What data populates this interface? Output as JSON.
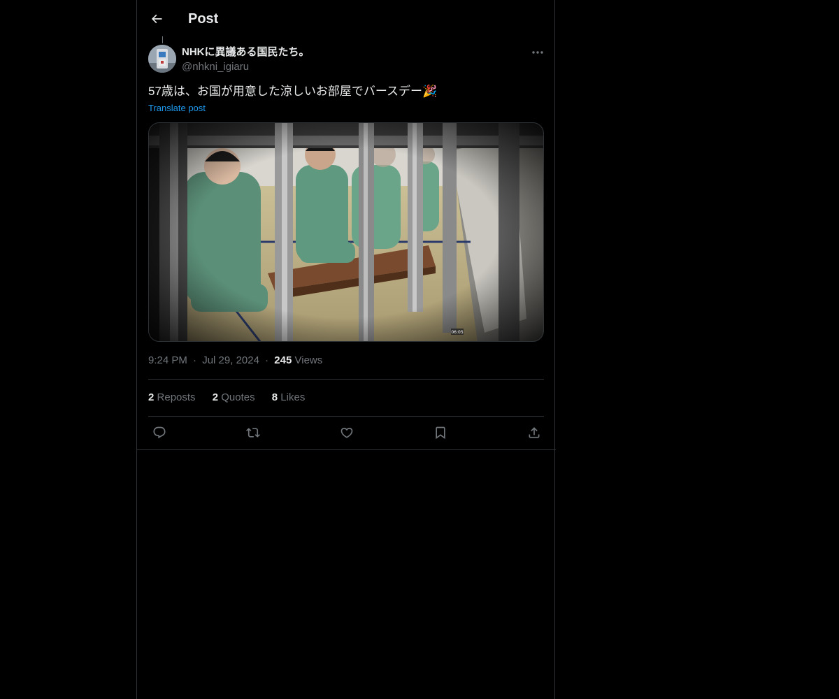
{
  "header": {
    "title": "Post",
    "back_icon": "arrow-left-icon"
  },
  "post": {
    "author": {
      "display_name": "NHKに異議ある国民たち。",
      "handle": "@nhkni_igiaru"
    },
    "text": "57歳は、お国が用意した涼しいお部屋でバースデー🎉",
    "translate_label": "Translate post",
    "media_timestamp": "06:05",
    "time": "9:24 PM",
    "separator": "·",
    "date": "Jul 29, 2024",
    "views_count": "245",
    "views_label": "Views"
  },
  "stats": [
    {
      "count": "2",
      "label": "Reposts"
    },
    {
      "count": "2",
      "label": "Quotes"
    },
    {
      "count": "8",
      "label": "Likes"
    }
  ],
  "actions": [
    {
      "icon": "reply-icon"
    },
    {
      "icon": "repost-icon"
    },
    {
      "icon": "like-icon"
    },
    {
      "icon": "bookmark-icon"
    },
    {
      "icon": "share-icon"
    }
  ],
  "colors": {
    "background": "#000000",
    "text_primary": "#e7e9ea",
    "text_secondary": "#71767b",
    "link": "#1d9bf0",
    "border": "#2f3336"
  }
}
